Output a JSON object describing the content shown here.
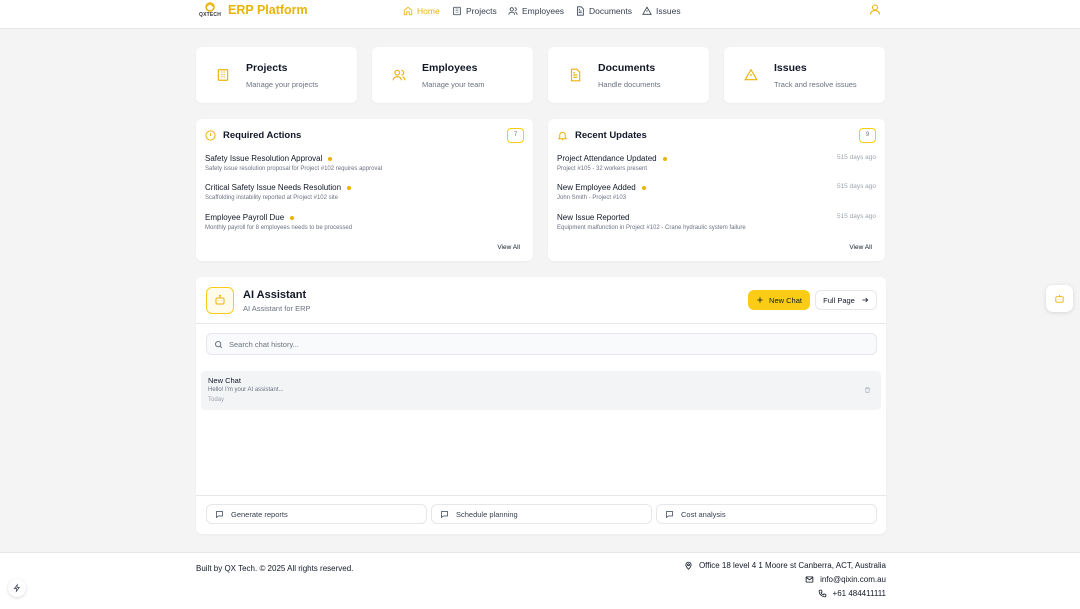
{
  "colors": {
    "accent": "#eab308",
    "accent_light": "#facc15",
    "background": "#f4f4f5"
  },
  "header": {
    "logo_text": "QXTECH",
    "app_title": "ERP Platform",
    "nav": [
      {
        "label": "Home",
        "icon": "home-icon",
        "active": true
      },
      {
        "label": "Projects",
        "icon": "building-icon"
      },
      {
        "label": "Employees",
        "icon": "users-icon"
      },
      {
        "label": "Documents",
        "icon": "document-icon"
      },
      {
        "label": "Issues",
        "icon": "warning-icon"
      }
    ]
  },
  "quick_links": [
    {
      "title": "Projects",
      "subtitle": "Manage your projects",
      "icon": "building-icon"
    },
    {
      "title": "Employees",
      "subtitle": "Manage your team",
      "icon": "users-icon"
    },
    {
      "title": "Documents",
      "subtitle": "Handle documents",
      "icon": "document-icon"
    },
    {
      "title": "Issues",
      "subtitle": "Track and resolve issues",
      "icon": "warning-icon"
    }
  ],
  "required_actions": {
    "title": "Required Actions",
    "count": "7",
    "items": [
      {
        "title": "Safety Issue Resolution Approval",
        "subtitle": "Safety issue resolution proposal for Project #102 requires approval"
      },
      {
        "title": "Critical Safety Issue Needs Resolution",
        "subtitle": "Scaffolding instability reported at Project #102 site"
      },
      {
        "title": "Employee Payroll Due",
        "subtitle": "Monthly payroll for 8 employees needs to be processed"
      }
    ],
    "view_all": "View All"
  },
  "recent_updates": {
    "title": "Recent Updates",
    "count": "9",
    "items": [
      {
        "title": "Project Attendance Updated",
        "subtitle": "Project #105 - 32 workers present",
        "time": "515 days ago",
        "new": true
      },
      {
        "title": "New Employee Added",
        "subtitle": "John Smith - Project #103",
        "time": "515 days ago",
        "new": true
      },
      {
        "title": "New Issue Reported",
        "subtitle": "Equipment malfunction in Project #102 - Crane hydraulic system failure",
        "time": "515 days ago",
        "new": false
      }
    ],
    "view_all": "View All"
  },
  "ai_assistant": {
    "title": "AI Assistant",
    "subtitle": "AI Assistant for ERP",
    "new_chat_label": "New Chat",
    "full_page_label": "Full Page",
    "search_placeholder": "Search chat history...",
    "chats": [
      {
        "title": "New Chat",
        "preview": "Hello! I'm your AI assistant...",
        "date": "Today"
      }
    ],
    "suggestions": [
      "Generate reports",
      "Schedule planning",
      "Cost analysis"
    ]
  },
  "footer": {
    "copyright": "Built by QX Tech. © 2025 All rights reserved.",
    "address": "Office 18 level 4 1 Moore st Canberra, ACT, Australia",
    "email": "info@qixin.com.au",
    "phone": "+61 484411111"
  }
}
